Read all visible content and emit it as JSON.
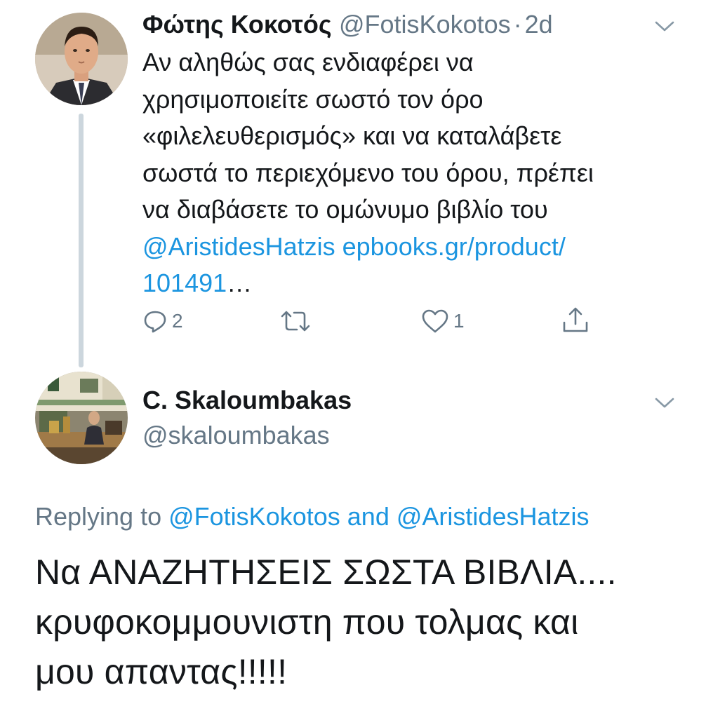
{
  "tweet1": {
    "name": "Φώτης Κοκοτός",
    "handle": "@FotisKokotos",
    "separator": "·",
    "time": "2d",
    "lines": [
      "Αν αληθώς σας ενδιαφέρει να",
      "χρησιμοποιείτε σωστό τον όρο",
      "«φιλελευθερισμός» και να καταλάβετε",
      "σωστά το περιεχόμενο του όρου, πρέπει",
      "να διαβάσετε το ομώνυμο βιβλίο του"
    ],
    "mention": "@AristidesHatzis",
    "url_part1": "epbooks.gr/product/",
    "url_part2": "101491",
    "ellipsis": "…",
    "actions": {
      "reply_count": "2",
      "like_count": "1"
    }
  },
  "tweet2": {
    "name": "C. Skaloumbakas",
    "handle": "@skaloumbakas",
    "replying_prefix": "Replying to",
    "replying_user1": "@FotisKokotos",
    "replying_and": "and",
    "replying_user2": "@AristidesHatzis",
    "lines": [
      "Να ΑΝΑΖΗΤΗΣΕΙΣ ΣΩΣΤΑ ΒΙΒΛΙΑ....",
      "κρυφοκομμουνιστη που τολμας και",
      "μου απαντας!!!!!"
    ]
  },
  "colors": {
    "link": "#1b95e0",
    "secondary": "#657786",
    "text": "#14171a",
    "thread_line": "#ccd6dd"
  },
  "icons": {
    "reply": "reply-icon",
    "retweet": "retweet-icon",
    "like": "heart-icon",
    "share": "share-icon",
    "menu": "chevron-down-icon"
  }
}
